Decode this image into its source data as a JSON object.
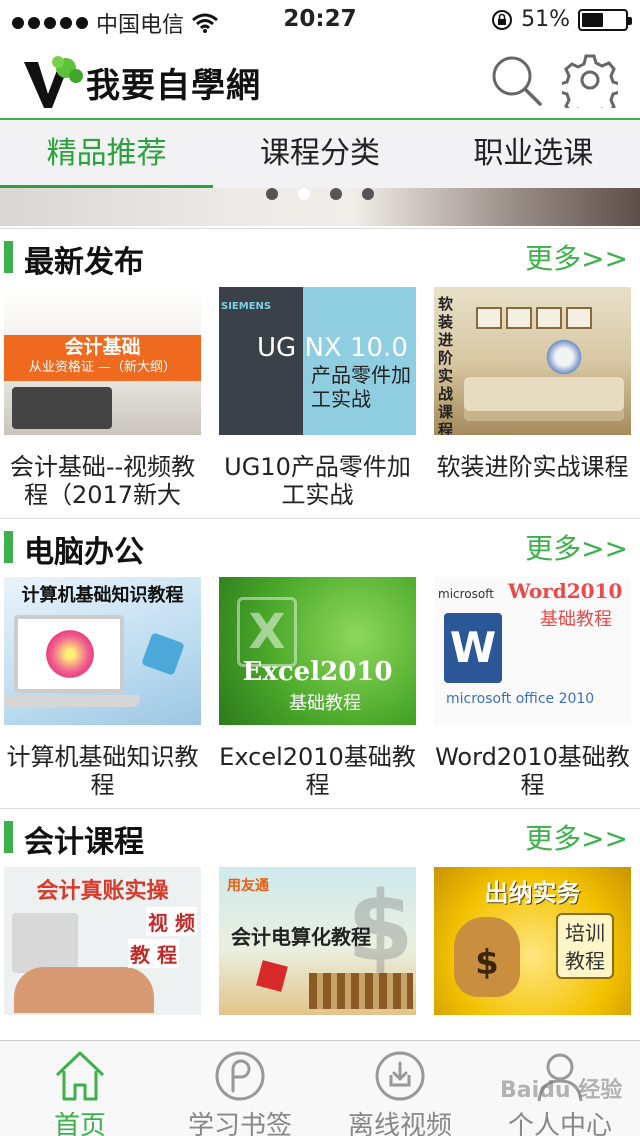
{
  "status_bar": {
    "carrier": "中国电信",
    "time": "20:27",
    "battery_text": "51%",
    "battery_level": 0.51
  },
  "header": {
    "logo_text": "我要自學網",
    "icons": [
      "search-icon",
      "gear-icon"
    ]
  },
  "tabs": [
    {
      "label": "精品推荐",
      "active": true
    },
    {
      "label": "课程分类",
      "active": false
    },
    {
      "label": "职业选课",
      "active": false
    }
  ],
  "banner": {
    "page_count": 4,
    "active_index": 1
  },
  "colors": {
    "accent": "#3cb04a",
    "tab_bg": "#f2f2f4",
    "more": "#3cb04a"
  },
  "sections": [
    {
      "title": "最新发布",
      "more": "更多>>",
      "items": [
        {
          "title": "会计基础--视频教程（2017新大",
          "thumb_heading": "会计基础",
          "thumb_sub": "从业资格证 —（新大纲）"
        },
        {
          "title": "UG10产品零件加工实战",
          "thumb_brand": "SIEMENS",
          "thumb_heading": "UG NX 10.0",
          "thumb_sub": "产品零件加工实战"
        },
        {
          "title": "软装进阶实战课程",
          "thumb_heading": "软装进阶实战课程"
        }
      ]
    },
    {
      "title": "电脑办公",
      "more": "更多>>",
      "items": [
        {
          "title": "计算机基础知识教程",
          "thumb_heading": "计算机基础知识教程"
        },
        {
          "title": "Excel2010基础教程",
          "thumb_mark": "X",
          "thumb_heading": "Excel2010",
          "thumb_sub": "基础教程"
        },
        {
          "title": "Word2010基础教程",
          "thumb_brand": "microsoft",
          "thumb_heading": "Word2010",
          "thumb_sub": "基础教程",
          "thumb_mark": "W",
          "thumb_footer": "microsoft office 2010"
        }
      ]
    },
    {
      "title": "会计课程",
      "more": "更多>>",
      "items": [
        {
          "thumb_heading": "会计真账实操",
          "thumb_sub_a": "视 频",
          "thumb_sub_b": "教 程"
        },
        {
          "thumb_brand": "用友通",
          "thumb_heading": "会计电算化教程",
          "thumb_mark": "$"
        },
        {
          "thumb_heading": "出纳实务",
          "thumb_sub": "培训教程",
          "thumb_mark": "$"
        }
      ]
    }
  ],
  "tabbar": [
    {
      "label": "首页",
      "icon": "home-icon",
      "active": true
    },
    {
      "label": "学习书签",
      "icon": "bookmark-icon",
      "active": false
    },
    {
      "label": "离线视频",
      "icon": "download-icon",
      "active": false
    },
    {
      "label": "个人中心",
      "icon": "user-icon",
      "active": false
    }
  ],
  "watermark": "Baidu 经验"
}
